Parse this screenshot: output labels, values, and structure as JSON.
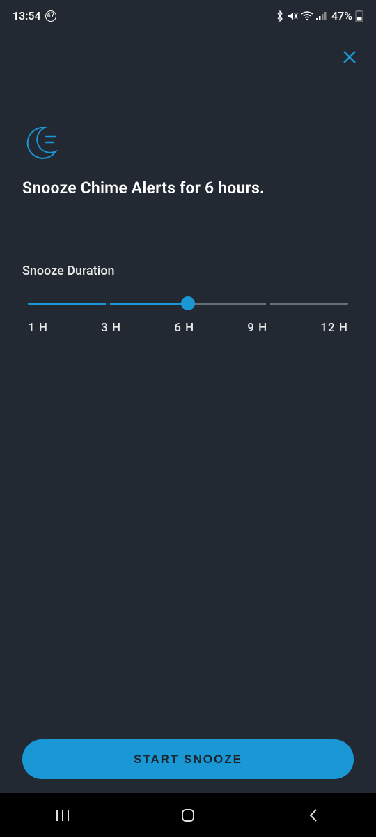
{
  "status_bar": {
    "time": "13:54",
    "badge": "47",
    "battery_pct": "47%"
  },
  "title": "Snooze Chime Alerts for 6 hours.",
  "section_label": "Snooze Duration",
  "slider": {
    "options": [
      "1 H",
      "3 H",
      "6 H",
      "9 H",
      "12 H"
    ],
    "selected_index": 2,
    "fill_percent": 50
  },
  "button": {
    "start_label": "START SNOOZE"
  }
}
